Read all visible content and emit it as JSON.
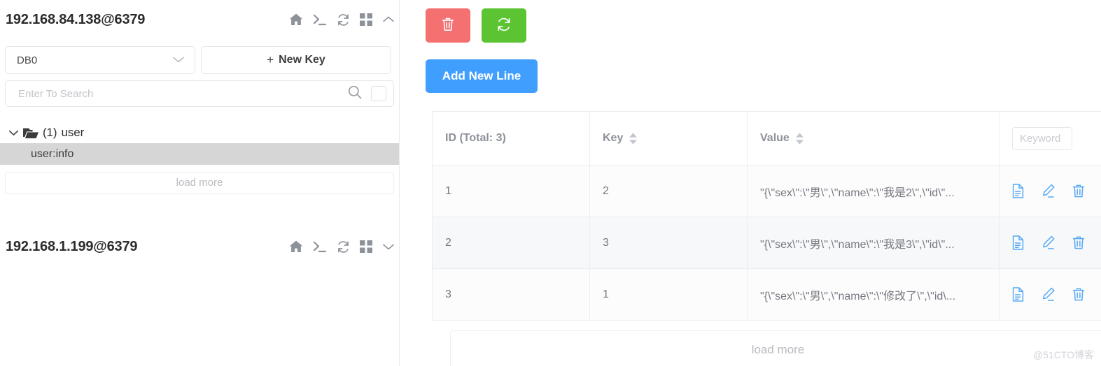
{
  "sidebar": {
    "connections": [
      {
        "title": "192.168.84.138@6379",
        "icons": [
          "home-icon",
          "terminal-icon",
          "refresh-icon",
          "grid-icon",
          "chevron-up-icon"
        ],
        "expanded": true
      },
      {
        "title": "192.168.1.199@6379",
        "icons": [
          "home-icon",
          "terminal-icon",
          "refresh-icon",
          "grid-icon",
          "chevron-down-icon"
        ],
        "expanded": false
      }
    ],
    "db_select": {
      "value": "DB0",
      "caret_icon": "chevron-down-icon"
    },
    "new_key_button": {
      "plus": "+",
      "label": "New Key"
    },
    "search": {
      "value": "",
      "placeholder": "Enter To Search",
      "search_icon": "search-icon",
      "checkbox_checked": false
    },
    "tree": {
      "folder": {
        "caret_icon": "chevron-down-icon",
        "folder_icon": "folder-open-icon",
        "count": "(1)",
        "label": "user"
      },
      "leaf": {
        "label": "user:info",
        "selected": true
      }
    },
    "load_more_label": "load more"
  },
  "toolbar": {
    "delete_button": {
      "icon": "trash-icon",
      "color": "#f57070"
    },
    "refresh_button": {
      "icon": "refresh-icon",
      "color": "#5cc433"
    },
    "add_new_line_button": {
      "label": "Add New Line",
      "color": "#409eff"
    }
  },
  "table": {
    "columns": [
      {
        "label": "ID (Total: 3)",
        "sortable": false
      },
      {
        "label": "Key",
        "sortable": true,
        "sort_icon": "sort-arrows-icon"
      },
      {
        "label": "Value",
        "sortable": true,
        "sort_icon": "sort-arrows-icon"
      },
      {
        "label": "",
        "filter": {
          "value": "",
          "placeholder": "Keyword"
        }
      }
    ],
    "rows": [
      {
        "id": "1",
        "key": "2",
        "value": "\"{\\\"sex\\\":\\\"男\\\",\\\"name\\\":\\\"我是2\\\",\\\"id\\\"...",
        "actions": [
          "detail-icon",
          "edit-icon",
          "delete-icon"
        ]
      },
      {
        "id": "2",
        "key": "3",
        "value": "\"{\\\"sex\\\":\\\"男\\\",\\\"name\\\":\\\"我是3\\\",\\\"id\\\"...",
        "actions": [
          "detail-icon",
          "edit-icon",
          "delete-icon"
        ]
      },
      {
        "id": "3",
        "key": "1",
        "value": "\"{\\\"sex\\\":\\\"男\\\",\\\"name\\\":\\\"修改了\\\",\\\"id\\...",
        "actions": [
          "detail-icon",
          "edit-icon",
          "delete-icon"
        ]
      }
    ],
    "load_more_label": "load more"
  },
  "watermark": "@51CTO博客"
}
